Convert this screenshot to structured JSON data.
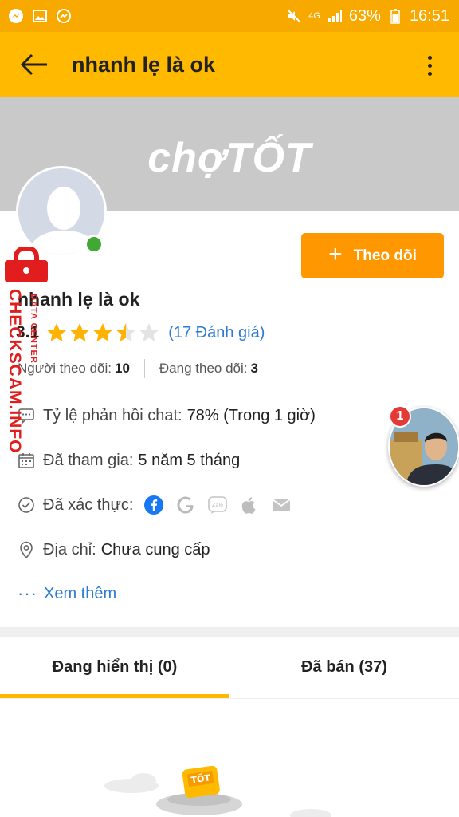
{
  "status_bar": {
    "battery": "63%",
    "time": "16:51",
    "network": "4G"
  },
  "app_bar": {
    "title": "nhanh lẹ là ok"
  },
  "cover": {
    "logo_text": "chợTỐT"
  },
  "profile": {
    "name": "nhanh lẹ là ok",
    "rating_score": "3.1",
    "rating_value": 3.5,
    "rating_max": 5,
    "rating_count": "(17 Đánh giá)",
    "follow_button": "Theo dõi",
    "followers_label": "Người theo dõi:",
    "followers_value": "10",
    "following_label": "Đang theo dõi:",
    "following_value": "3"
  },
  "info": {
    "response_label": "Tỷ lệ phản hồi chat:",
    "response_value": "78%  (Trong 1 giờ)",
    "joined_label": "Đã tham gia:",
    "joined_value": "5 năm 5 tháng",
    "verified_label": "Đã xác thực:",
    "verified_icons": [
      "facebook-icon",
      "google-icon",
      "zalo-icon",
      "apple-icon",
      "email-icon"
    ],
    "address_label": "Địa chỉ:",
    "address_value": "Chưa cung cấp",
    "see_more": "Xem thêm"
  },
  "tabs": [
    {
      "label": "Đang hiển thị (0)",
      "active": true
    },
    {
      "label": "Đã bán (37)",
      "active": false
    }
  ],
  "watermark": {
    "main": "CHECKSCAM.INFO",
    "sub": "DATA CENTER"
  },
  "chat_head": {
    "badge": "1"
  },
  "colors": {
    "accent": "#ffba00",
    "button": "#ff9800",
    "link": "#2c7bd0",
    "online": "#3fa934"
  }
}
